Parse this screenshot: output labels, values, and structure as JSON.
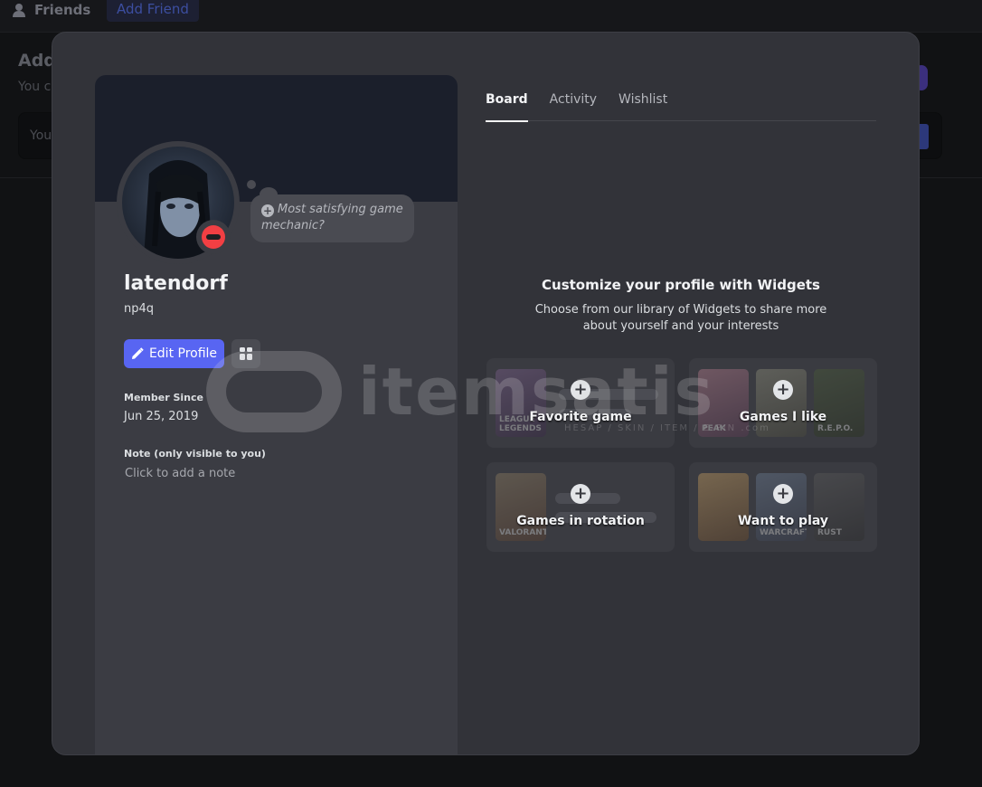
{
  "background": {
    "nav_friends": "Friends",
    "nav_add_friend": "Add Friend",
    "title": "Add",
    "subtitle": "You c",
    "input_placeholder": "You"
  },
  "profile": {
    "bubble_text": "Most satisfying game mechanic?",
    "username": "latendorf",
    "tag": "np4q",
    "status": "do-not-disturb",
    "edit_profile_label": "Edit Profile",
    "member_since_label": "Member Since",
    "member_since_value": "Jun 25, 2019",
    "note_label": "Note (only visible to you)",
    "note_placeholder": "Click to add a note"
  },
  "tabs": [
    {
      "label": "Board",
      "active": true
    },
    {
      "label": "Activity",
      "active": false
    },
    {
      "label": "Wishlist",
      "active": false
    }
  ],
  "board": {
    "title": "Customize your profile with Widgets",
    "description": "Choose from our library of Widgets to share more about yourself and your interests",
    "widgets": [
      {
        "label": "Favorite game",
        "thumb_labels": [
          "LEAGUE LEGENDS"
        ]
      },
      {
        "label": "Games I like",
        "thumb_labels": [
          "PEAK",
          "",
          "R.E.P.O."
        ]
      },
      {
        "label": "Games in rotation",
        "thumb_labels": [
          "VALORANT"
        ]
      },
      {
        "label": "Want to play",
        "thumb_labels": [
          "",
          "WARCRAFT",
          "RUST"
        ]
      }
    ]
  },
  "watermark": {
    "text": "itemsatis",
    "sub": "HESAP / SKIN / ITEM / E-PIN",
    "domain": ".com"
  },
  "colors": {
    "accent": "#5865f2",
    "dnd": "#f23f43",
    "modal_bg": "#323339",
    "card_bg": "#3b3c43"
  }
}
